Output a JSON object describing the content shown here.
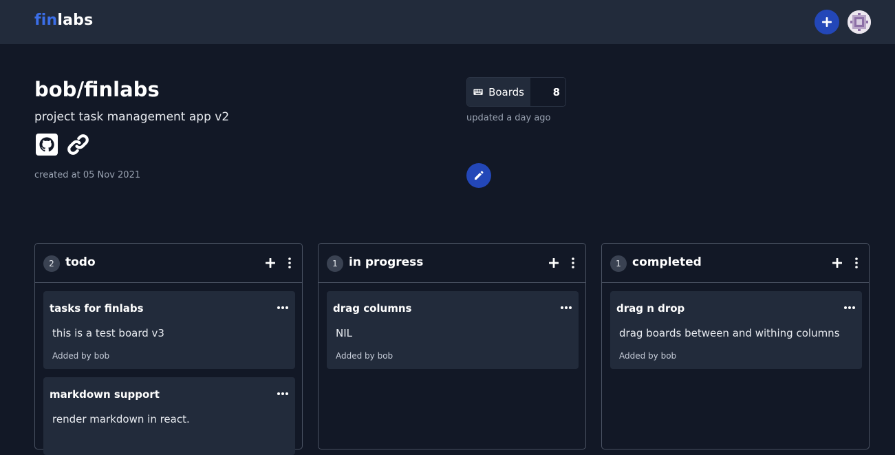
{
  "header": {
    "logo_part1": "fin",
    "logo_part2": "labs",
    "add_icon": "plus-icon",
    "avatar_icon": "user-avatar"
  },
  "project": {
    "title": "bob/finlabs",
    "description": "project task management app v2",
    "created": "created at 05 Nov 2021",
    "links": [
      "github-icon",
      "link-icon"
    ]
  },
  "stats": {
    "boards_label": "Boards",
    "boards_count": "8",
    "updated": "updated a day ago",
    "boards_icon": "keyboard-icon",
    "edit_icon": "pencil-icon"
  },
  "columns": [
    {
      "title": "todo",
      "count": "2",
      "cards": [
        {
          "title": "tasks for finlabs",
          "body": "this is a test board v3",
          "meta": "Added by bob"
        },
        {
          "title": "markdown support",
          "body": "render markdown in react.",
          "meta": ""
        }
      ]
    },
    {
      "title": "in progress",
      "count": "1",
      "cards": [
        {
          "title": "drag columns",
          "body": "NIL",
          "meta": "Added by bob"
        }
      ]
    },
    {
      "title": "completed",
      "count": "1",
      "cards": [
        {
          "title": "drag n drop",
          "body": "drag boards between and withing columns",
          "meta": "Added by bob"
        }
      ]
    }
  ],
  "colors": {
    "background": "#121826",
    "surface": "#222b3b",
    "accent": "#2347b8",
    "logo_accent": "#3b6ee8",
    "border": "#4a5262"
  }
}
